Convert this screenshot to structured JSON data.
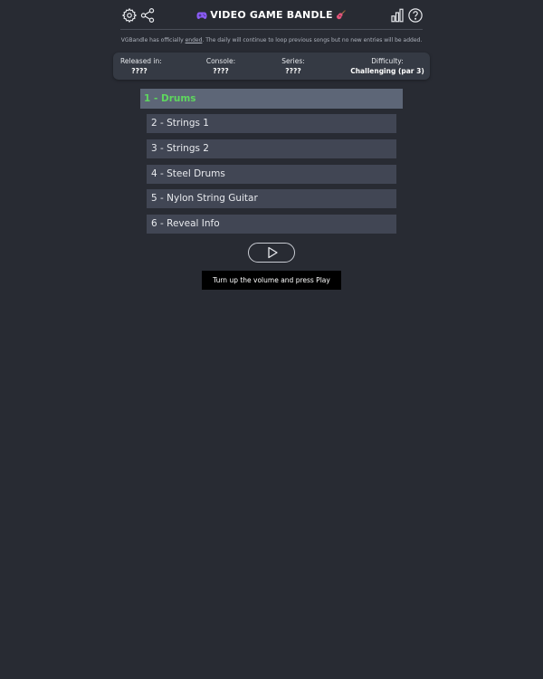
{
  "header": {
    "title": "VIDEO GAME BANDLE",
    "icons": {
      "settings": "gear-icon",
      "share": "share-icon",
      "stats": "bar-chart-icon",
      "help": "help-icon",
      "title_left": "gamepad-icon",
      "title_right": "guitar-icon"
    }
  },
  "notice": {
    "before": "VGBandle has officially ",
    "link": "ended",
    "after": ". The daily will continue to loop previous songs but no new entries will be added."
  },
  "info": {
    "released": {
      "label": "Released in:",
      "value": "????"
    },
    "console": {
      "label": "Console:",
      "value": "????"
    },
    "series": {
      "label": "Series:",
      "value": "????"
    },
    "difficulty": {
      "label": "Difficulty:",
      "value": "Challenging (par 3)"
    }
  },
  "tracks": [
    {
      "label": "1 - Drums",
      "active": true
    },
    {
      "label": "2 - Strings 1",
      "active": false
    },
    {
      "label": "3 - Strings 2",
      "active": false
    },
    {
      "label": "4 - Steel Drums",
      "active": false
    },
    {
      "label": "5 - Nylon String Guitar",
      "active": false
    },
    {
      "label": "6 - Reveal Info",
      "active": false
    }
  ],
  "play": {
    "icon": "play-icon",
    "tooltip": "Turn up the volume and press Play"
  },
  "colors": {
    "background": "#282b33",
    "info_bar": "#353a44",
    "track": "#414654",
    "track_active": "#5d6677",
    "active_text": "#5ed75e",
    "tooltip": "#000000"
  }
}
